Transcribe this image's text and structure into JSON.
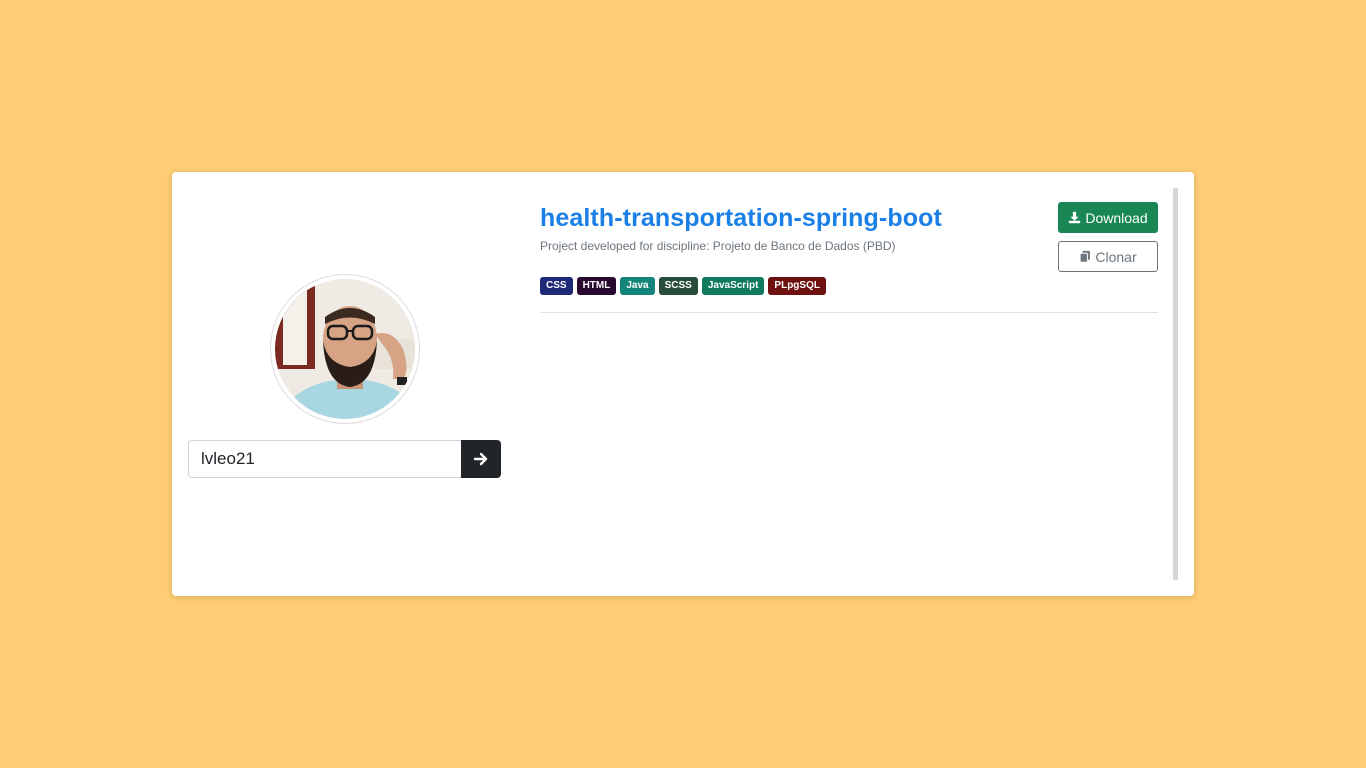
{
  "profile": {
    "username_value": "lvleo21",
    "avatar_alt": "profile photo"
  },
  "repo": {
    "title": "health-transportation-spring-boot",
    "description": "Project developed for discipline: Projeto de Banco de Dados (PBD)",
    "languages": [
      {
        "label": "CSS",
        "color": "#1e2a78"
      },
      {
        "label": "HTML",
        "color": "#27082e"
      },
      {
        "label": "Java",
        "color": "#138578"
      },
      {
        "label": "SCSS",
        "color": "#294d3b"
      },
      {
        "label": "JavaScript",
        "color": "#0f7a5e"
      },
      {
        "label": "PLpgSQL",
        "color": "#6e1010"
      }
    ]
  },
  "actions": {
    "download_label": "Download",
    "clone_label": "Clonar"
  },
  "colors": {
    "background": "#ffcd74",
    "title": "#1a7fe6",
    "download": "#198754",
    "search_button": "#212529"
  },
  "icons": {
    "submit": "arrow-right-icon",
    "download": "download-icon",
    "clone": "copy-icon"
  }
}
